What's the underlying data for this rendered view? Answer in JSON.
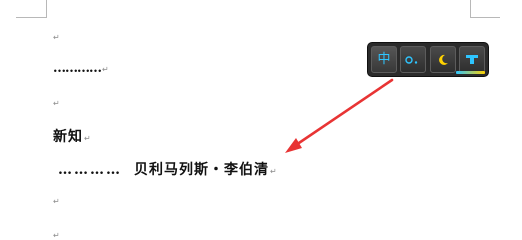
{
  "document": {
    "paragraph_mark": "↵",
    "dots_line": "…………",
    "heading": "新知",
    "author_dots": "…………",
    "author_name": "贝利马列斯・李伯清"
  },
  "ime_toolbar": {
    "buttons": [
      {
        "label": "中",
        "icon": "chinese-mode-icon"
      },
      {
        "icon": "half-width-punctuation-icon"
      },
      {
        "icon": "moon-skin-icon"
      },
      {
        "icon": "toolbox-icon"
      }
    ],
    "accent_color": "#2ec5ff",
    "moon_color": "#ffd200"
  },
  "annotation": {
    "arrow_color": "#e83434"
  }
}
